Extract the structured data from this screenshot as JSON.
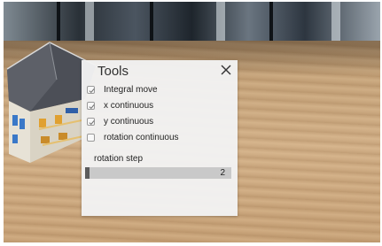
{
  "panel": {
    "title": "Tools",
    "close_glyph": "×",
    "options": [
      {
        "label": "Integral move",
        "checked": true
      },
      {
        "label": "x continuous",
        "checked": true
      },
      {
        "label": "y continuous",
        "checked": true
      },
      {
        "label": "rotation continuous",
        "checked": false
      }
    ],
    "rotation_step": {
      "label": "rotation step",
      "value": "2",
      "fill_fraction": 0.03
    }
  },
  "colors": {
    "panel_background": "#f2f2f2",
    "slider_track": "#c9c9c9",
    "slider_fill": "#5b5b5b",
    "floor": "#c7a57c"
  }
}
